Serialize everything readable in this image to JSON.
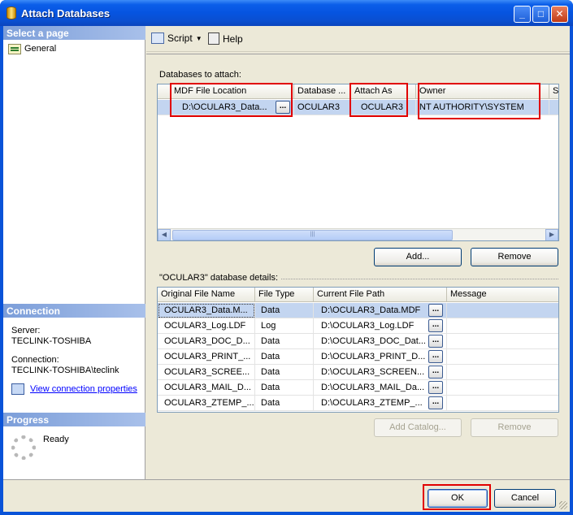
{
  "window": {
    "title": "Attach Databases"
  },
  "left": {
    "select_page": "Select a page",
    "pages": [
      {
        "label": "General"
      }
    ],
    "connection_head": "Connection",
    "server_label": "Server:",
    "server_value": "TECLINK-TOSHIBA",
    "connection_label": "Connection:",
    "connection_value": "TECLINK-TOSHIBA\\teclink",
    "view_link": "View connection properties",
    "progress_head": "Progress",
    "progress_status": "Ready"
  },
  "toolbar": {
    "script": "Script",
    "help": "Help"
  },
  "attach": {
    "label": "Databases to attach:",
    "columns": [
      "MDF File Location",
      "Database ...",
      "Attach As",
      "Owner",
      "S"
    ],
    "rows": [
      {
        "mdf": "D:\\OCULAR3_Data...",
        "database": "OCULAR3",
        "attach_as": "OCULAR3",
        "owner": "NT AUTHORITY\\SYSTEM",
        "s": ""
      }
    ],
    "add_button": "Add...",
    "remove_button": "Remove"
  },
  "details": {
    "label": "\"OCULAR3\" database details:",
    "columns": [
      "Original File Name",
      "File Type",
      "Current File Path",
      "Message"
    ],
    "rows": [
      {
        "name": "OCULAR3_Data.M...",
        "type": "Data",
        "path": "D:\\OCULAR3_Data.MDF",
        "message": ""
      },
      {
        "name": "OCULAR3_Log.LDF",
        "type": "Log",
        "path": "D:\\OCULAR3_Log.LDF",
        "message": ""
      },
      {
        "name": "OCULAR3_DOC_D...",
        "type": "Data",
        "path": "D:\\OCULAR3_DOC_Dat...",
        "message": ""
      },
      {
        "name": "OCULAR3_PRINT_...",
        "type": "Data",
        "path": "D:\\OCULAR3_PRINT_D...",
        "message": ""
      },
      {
        "name": "OCULAR3_SCREE...",
        "type": "Data",
        "path": "D:\\OCULAR3_SCREEN...",
        "message": ""
      },
      {
        "name": "OCULAR3_MAIL_D...",
        "type": "Data",
        "path": "D:\\OCULAR3_MAIL_Da...",
        "message": ""
      },
      {
        "name": "OCULAR3_ZTEMP_...",
        "type": "Data",
        "path": "D:\\OCULAR3_ZTEMP_...",
        "message": ""
      }
    ],
    "add_catalog_button": "Add Catalog...",
    "remove_button": "Remove"
  },
  "footer": {
    "ok": "OK",
    "cancel": "Cancel"
  },
  "ellipsis": "...",
  "colors": {
    "highlight": "#e10000",
    "title_blue": "#0654e0",
    "selection": "#c3d5f0"
  }
}
